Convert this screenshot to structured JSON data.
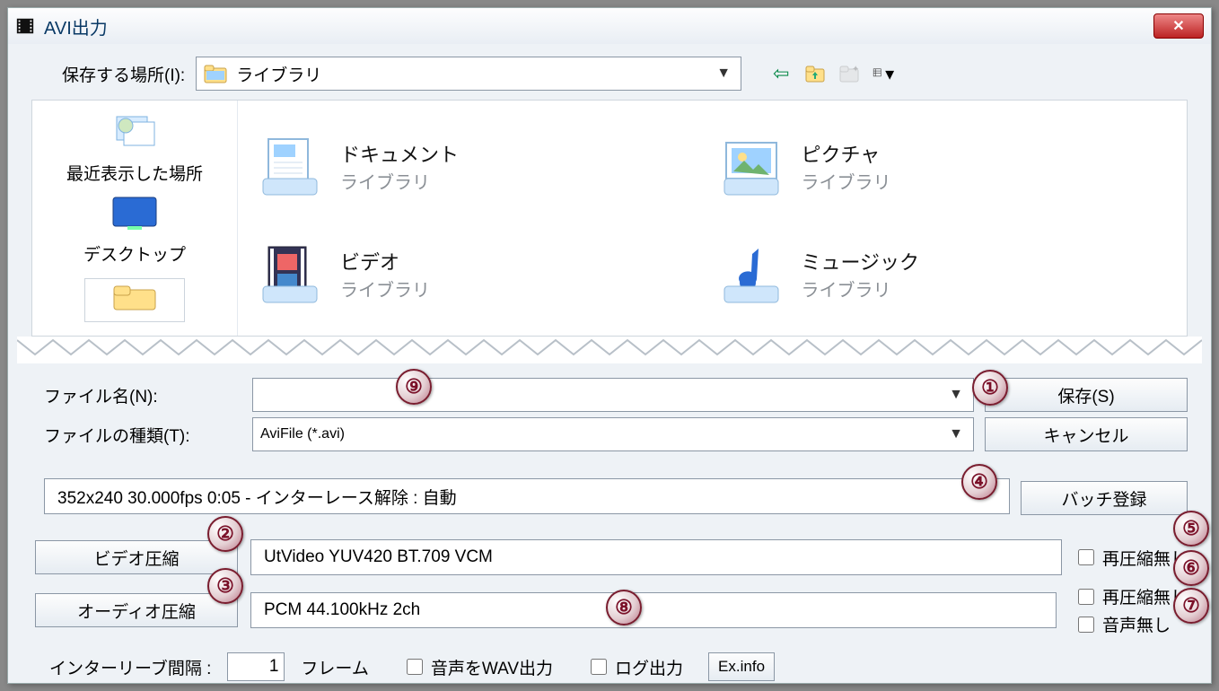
{
  "window": {
    "title": "AVI出力"
  },
  "toolbar": {
    "save_in_label": "保存する場所(I):",
    "location": "ライブラリ"
  },
  "sidebar": {
    "recent": "最近表示した場所",
    "desktop": "デスクトップ"
  },
  "folders": {
    "documents": {
      "name": "ドキュメント",
      "sub": "ライブラリ"
    },
    "pictures": {
      "name": "ピクチャ",
      "sub": "ライブラリ"
    },
    "videos": {
      "name": "ビデオ",
      "sub": "ライブラリ"
    },
    "music": {
      "name": "ミュージック",
      "sub": "ライブラリ"
    }
  },
  "fields": {
    "filename_label": "ファイル名(N):",
    "filetype_label": "ファイルの種類(T):",
    "filetype_value": "AviFile (*.avi)"
  },
  "buttons": {
    "save": "保存(S)",
    "cancel": "キャンセル",
    "batch": "バッチ登録",
    "video_codec": "ビデオ圧縮",
    "audio_codec": "オーディオ圧縮",
    "exinfo": "Ex.info"
  },
  "info": {
    "strip": "352x240  30.000fps  0:05  -  インターレース解除 : 自動"
  },
  "codecs": {
    "video": "UtVideo YUV420 BT.709 VCM",
    "audio": "PCM 44.100kHz 2ch"
  },
  "checks": {
    "no_recompress": "再圧縮無し",
    "no_audio": "音声無し"
  },
  "bottom": {
    "interleave_label": "インターリーブ間隔 :",
    "interleave_value": "1",
    "interleave_unit": "フレーム",
    "wav_out": "音声をWAV出力",
    "log_out": "ログ出力"
  },
  "badges": {
    "b1": "①",
    "b2": "②",
    "b3": "③",
    "b4": "④",
    "b5": "⑤",
    "b6": "⑥",
    "b7": "⑦",
    "b8": "⑧",
    "b9": "⑨"
  }
}
